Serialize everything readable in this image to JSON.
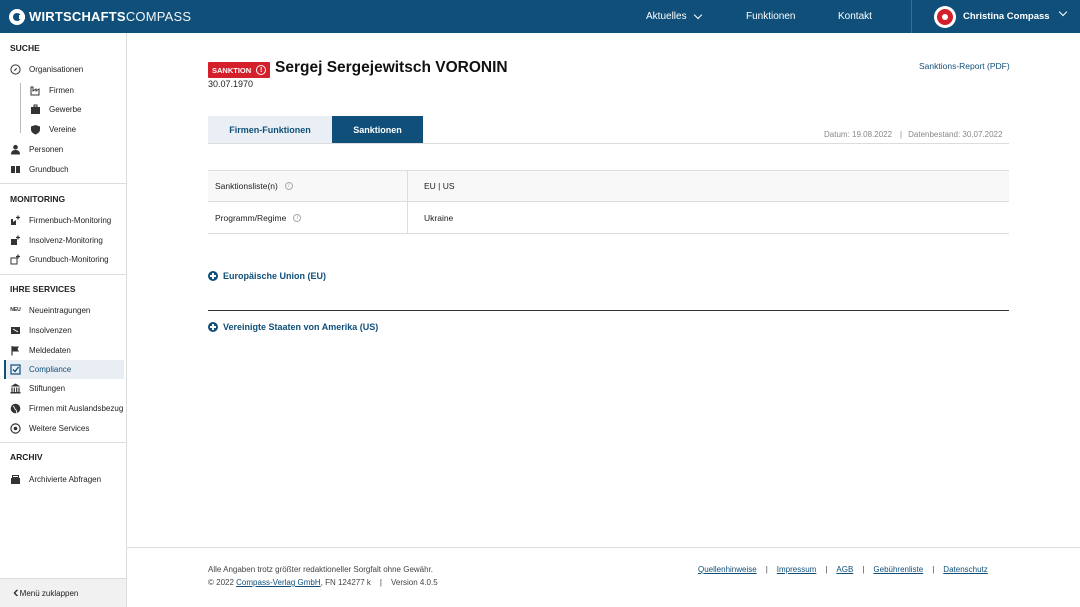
{
  "header": {
    "logo_bold": "WIRTSCHAFTS",
    "logo_thin": "COMPASS",
    "nav": [
      {
        "label": "Aktuelles"
      },
      {
        "label": "Funktionen"
      },
      {
        "label": "Kontakt"
      }
    ],
    "user_name": "Christina Compass"
  },
  "sidebar": {
    "sections": [
      {
        "title": "SUCHE"
      },
      {
        "title": "MONITORING"
      },
      {
        "title": "IHRE SERVICES"
      },
      {
        "title": "ARCHIV"
      }
    ],
    "suche": [
      "Organisationen",
      "Firmen",
      "Gewerbe",
      "Vereine",
      "Personen",
      "Grundbuch"
    ],
    "monitoring": [
      "Firmenbuch-Monitoring",
      "Insolvenz-Monitoring",
      "Grundbuch-Monitoring"
    ],
    "services": [
      "Neueintragungen",
      "Insolvenzen",
      "Meldedaten",
      "Compliance",
      "Stiftungen",
      "Firmen mit Auslandsbezug",
      "Weitere Services"
    ],
    "services_new_badge": "NEU",
    "archiv": [
      "Archivierte Abfragen"
    ],
    "collapse_label": "Menü zuklappen"
  },
  "main": {
    "badge": "SANKTION",
    "person_name": "Sergej Sergejewitsch VORONIN",
    "birth_date": "30.07.1970",
    "report_link": "Sanktions-Report (PDF)",
    "tabs": [
      {
        "label": "Firmen-Funktionen"
      },
      {
        "label": "Sanktionen"
      }
    ],
    "meta_date": "Datum: 19.08.2022",
    "meta_stand": "Datenbestand: 30.07.2022",
    "table": [
      {
        "label": "Sanktionsliste(n)",
        "value": "EU | US"
      },
      {
        "label": "Programm/Regime",
        "value": "Ukraine"
      }
    ],
    "accordions": [
      {
        "label": "Europäische Union (EU)"
      },
      {
        "label": "Vereinigte Staaten von Amerika (US)"
      }
    ]
  },
  "footer": {
    "disclaimer": "Alle Angaben trotz größter redaktioneller Sorgfalt ohne Gewähr.",
    "copyright": "© 2022",
    "company_link": "Compass-Verlag GmbH",
    "fn": ", FN 124277 k",
    "version": "Version 4.0.5",
    "links": [
      "Quellenhinweise",
      "Impressum",
      "AGB",
      "Gebührenliste",
      "Datenschutz"
    ]
  },
  "colors": {
    "primary": "#0f4f79",
    "sanction_red": "#d3202b",
    "tab_inactive_bg": "#e9eff4"
  }
}
